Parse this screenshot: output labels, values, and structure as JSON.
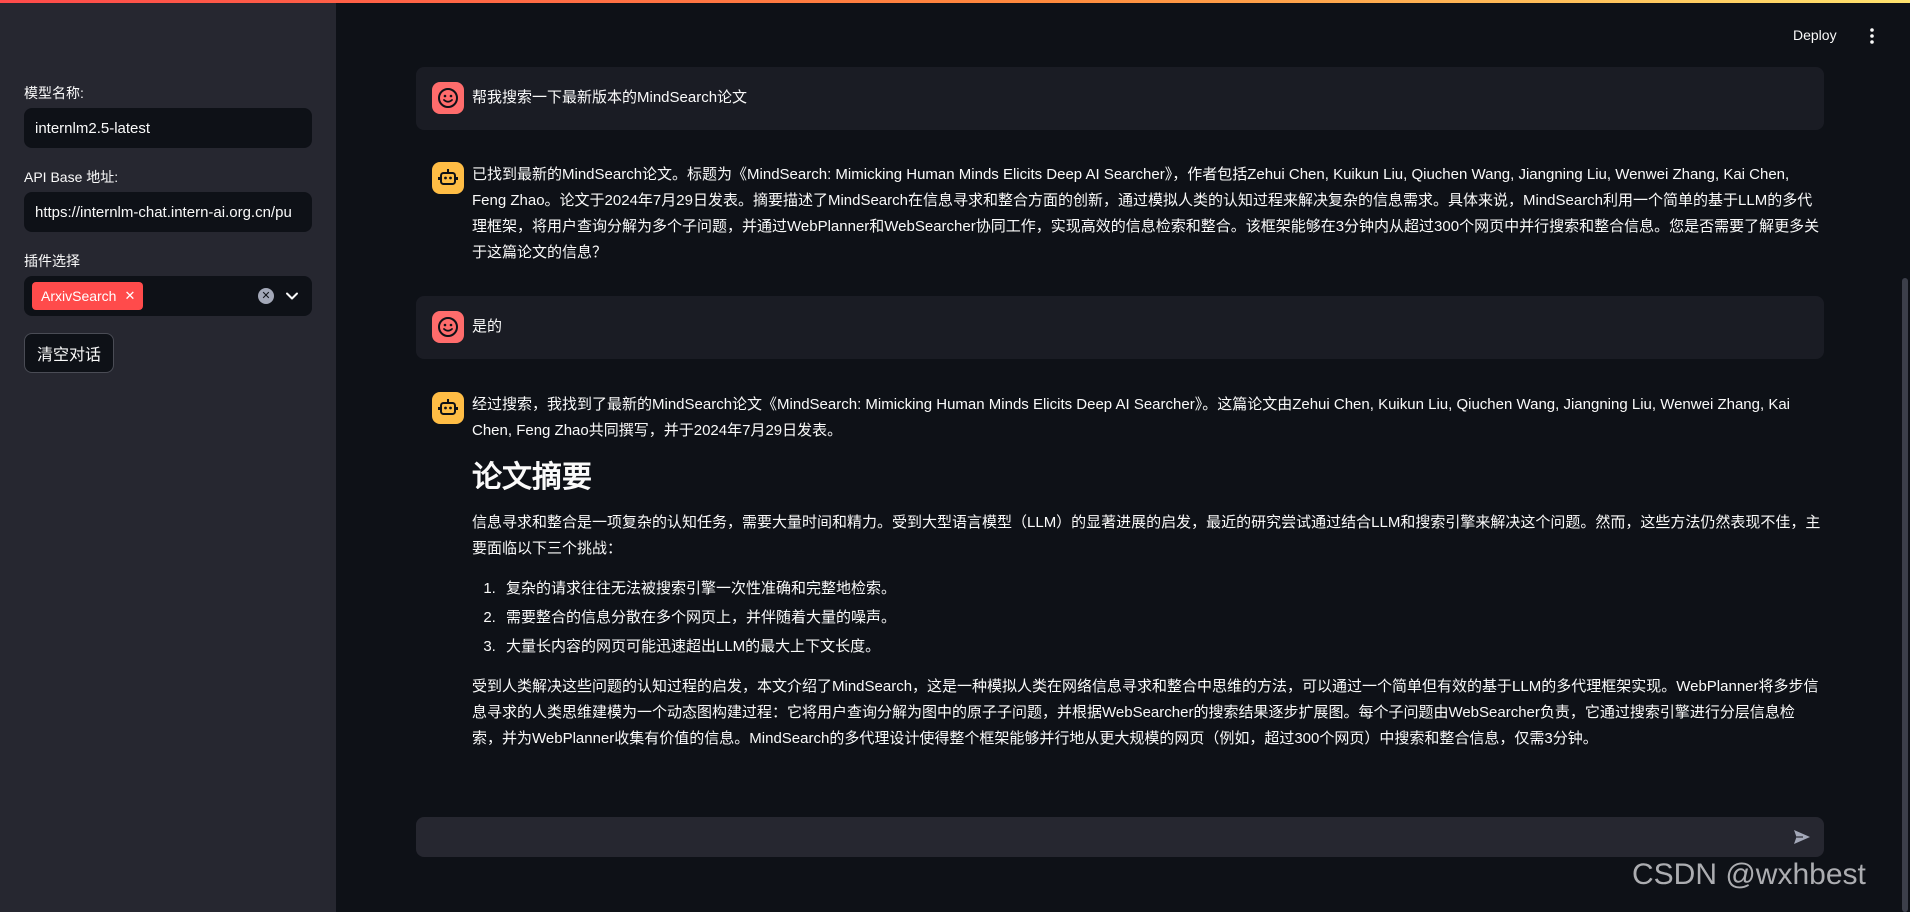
{
  "sidebar": {
    "model_label": "模型名称:",
    "model_value": "internlm2.5-latest",
    "api_label": "API Base 地址:",
    "api_value": "https://internlm-chat.intern-ai.org.cn/pu",
    "plugin_label": "插件选择",
    "plugin_tag": "ArxivSearch",
    "clear_button": "清空对话"
  },
  "header": {
    "deploy_label": "Deploy"
  },
  "messages": {
    "user1": "帮我搜索一下最新版本的MindSearch论文",
    "bot1": "已找到最新的MindSearch论文。标题为《MindSearch: Mimicking Human Minds Elicits Deep AI Searcher》，作者包括Zehui Chen, Kuikun Liu, Qiuchen Wang, Jiangning Liu, Wenwei Zhang, Kai Chen, Feng Zhao。论文于2024年7月29日发表。摘要描述了MindSearch在信息寻求和整合方面的创新，通过模拟人类的认知过程来解决复杂的信息需求。具体来说，MindSearch利用一个简单的基于LLM的多代理框架，将用户查询分解为多个子问题，并通过WebPlanner和WebSearcher协同工作，实现高效的信息检索和整合。该框架能够在3分钟内从超过300个网页中并行搜索和整合信息。您是否需要了解更多关于这篇论文的信息？",
    "user2": "是的",
    "bot2": {
      "intro": "经过搜索，我找到了最新的MindSearch论文《MindSearch: Mimicking Human Minds Elicits Deep AI Searcher》。这篇论文由Zehui Chen, Kuikun Liu, Qiuchen Wang, Jiangning Liu, Wenwei Zhang, Kai Chen, Feng Zhao共同撰写，并于2024年7月29日发表。",
      "heading": "论文摘要",
      "para1": "信息寻求和整合是一项复杂的认知任务，需要大量时间和精力。受到大型语言模型（LLM）的显著进展的启发，最近的研究尝试通过结合LLM和搜索引擎来解决这个问题。然而，这些方法仍然表现不佳，主要面临以下三个挑战：",
      "items": [
        "复杂的请求往往无法被搜索引擎一次性准确和完整地检索。",
        "需要整合的信息分散在多个网页上，并伴随着大量的噪声。",
        "大量长内容的网页可能迅速超出LLM的最大上下文长度。"
      ],
      "para2": "受到人类解决这些问题的认知过程的启发，本文介绍了MindSearch，这是一种模拟人类在网络信息寻求和整合中思维的方法，可以通过一个简单但有效的基于LLM的多代理框架实现。WebPlanner将多步信息寻求的人类思维建模为一个动态图构建过程：它将用户查询分解为图中的原子子问题，并根据WebSearcher的搜索结果逐步扩展图。每个子问题由WebSearcher负责，它通过搜索引擎进行分层信息检索，并为WebPlanner收集有价值的信息。MindSearch的多代理设计使得整个框架能够并行地从更大规模的网页（例如，超过300个网页）中搜索和整合信息，仅需3分钟。"
    }
  },
  "chat_input": {
    "value": ""
  },
  "watermark": "CSDN @wxhbest",
  "colors": {
    "app_bg": "#0e1117",
    "sidebar_bg": "#262730",
    "accent": "#ff4b4b",
    "user_avatar": "#ff6c6c",
    "bot_avatar": "#ffbd45"
  },
  "icons": {
    "user_avatar": "smiley-face-icon",
    "bot_avatar": "robot-icon",
    "send": "send-arrow-icon",
    "menu": "kebab-menu-icon",
    "clear": "clear-circle-icon",
    "dropdown": "chevron-down-icon"
  }
}
